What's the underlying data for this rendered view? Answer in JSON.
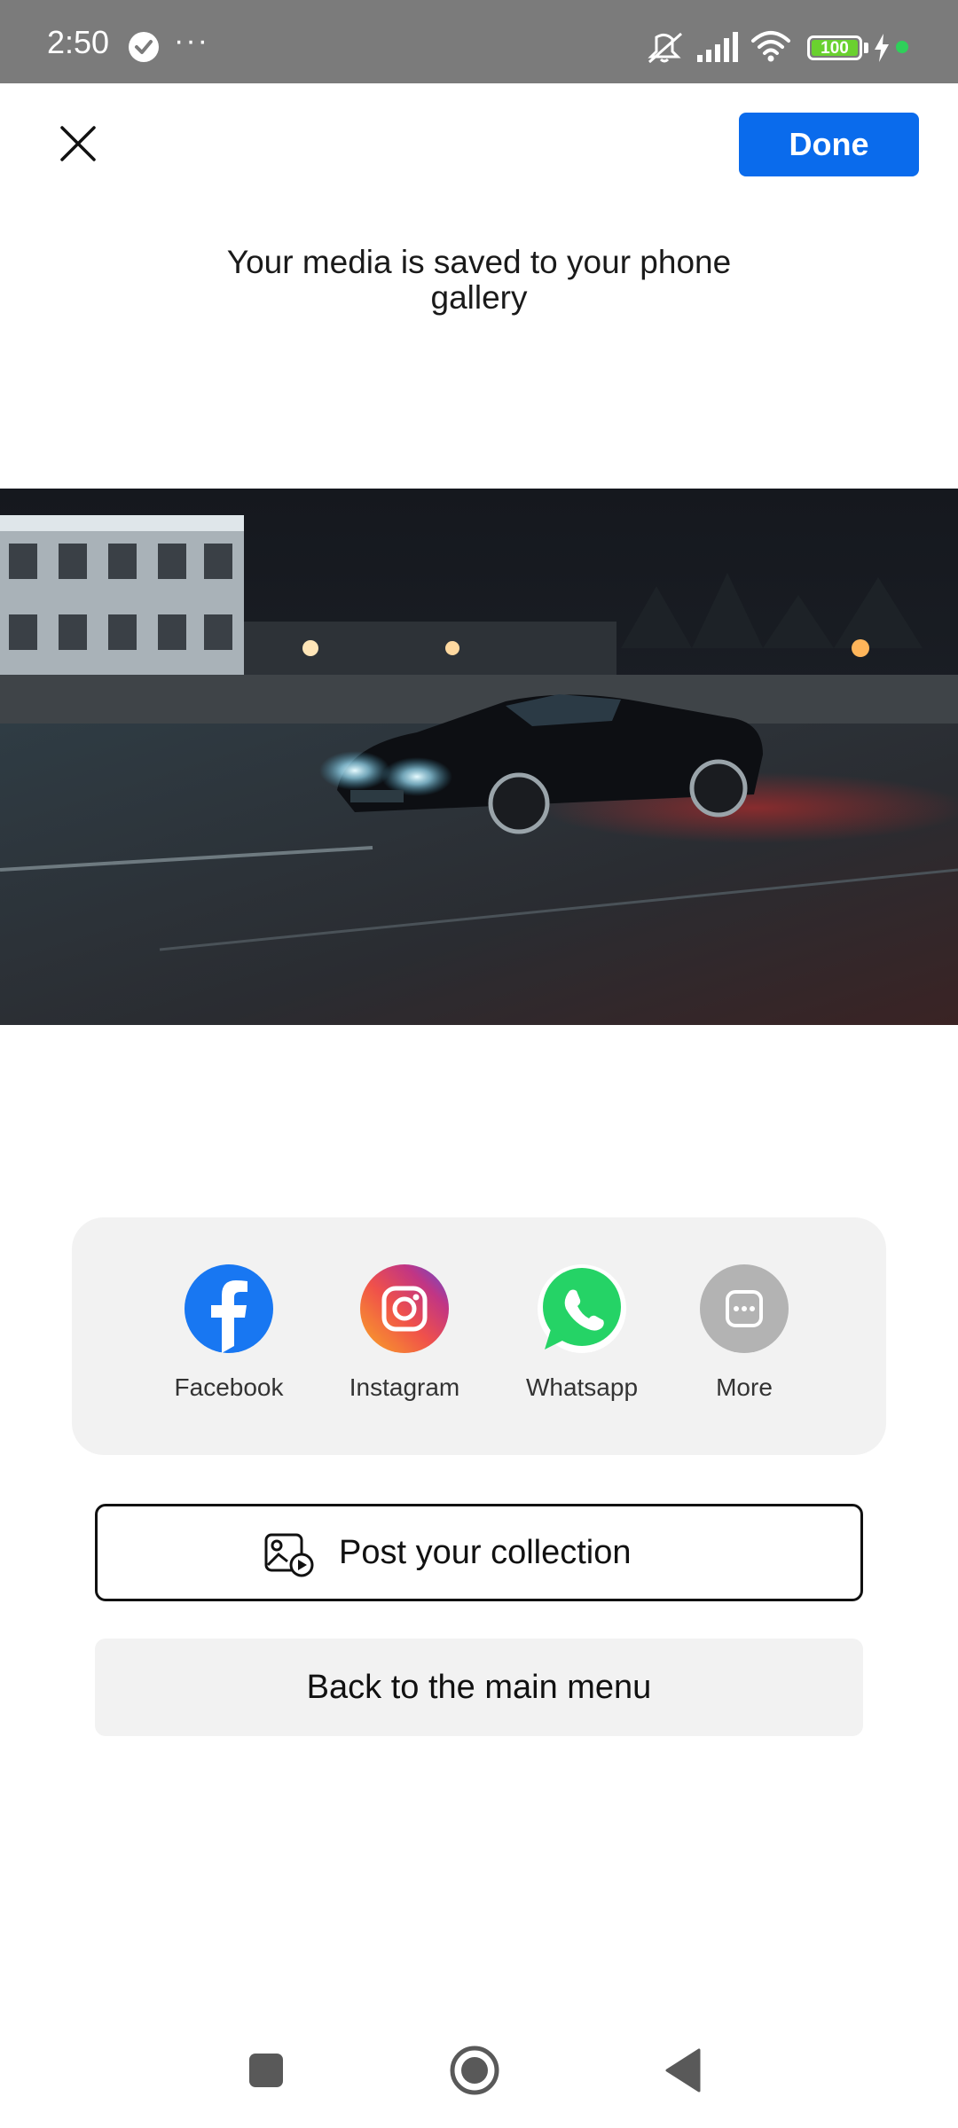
{
  "status_bar": {
    "time": "2:50",
    "more_indicator": "···",
    "battery_level": "100",
    "icons": [
      "check-circle-icon",
      "mute-icon",
      "signal-icon",
      "wifi-icon",
      "battery-icon",
      "charging-icon"
    ]
  },
  "header": {
    "close_icon": "close-icon",
    "done_label": "Done",
    "title": "Your media is saved to your phone gallery"
  },
  "media": {
    "description_icon": "media-preview"
  },
  "share": {
    "items": [
      {
        "label": "Facebook",
        "icon": "facebook-icon",
        "color": "#1877f2"
      },
      {
        "label": "Instagram",
        "icon": "instagram-icon",
        "color": "#e1306c"
      },
      {
        "label": "Whatsapp",
        "icon": "whatsapp-icon",
        "color": "#25d366"
      },
      {
        "label": "More",
        "icon": "more-icon",
        "color": "#b3b3b3"
      }
    ]
  },
  "actions": {
    "post_label": "Post your collection",
    "post_icon": "gallery-post-icon",
    "back_label": "Back to the main menu"
  },
  "nav_bar": {
    "icons": [
      "recents-icon",
      "home-icon",
      "back-icon"
    ]
  },
  "colors": {
    "accent": "#0a6bec",
    "status_bar": "#7b7b7b",
    "card_bg": "#f2f2f2"
  }
}
